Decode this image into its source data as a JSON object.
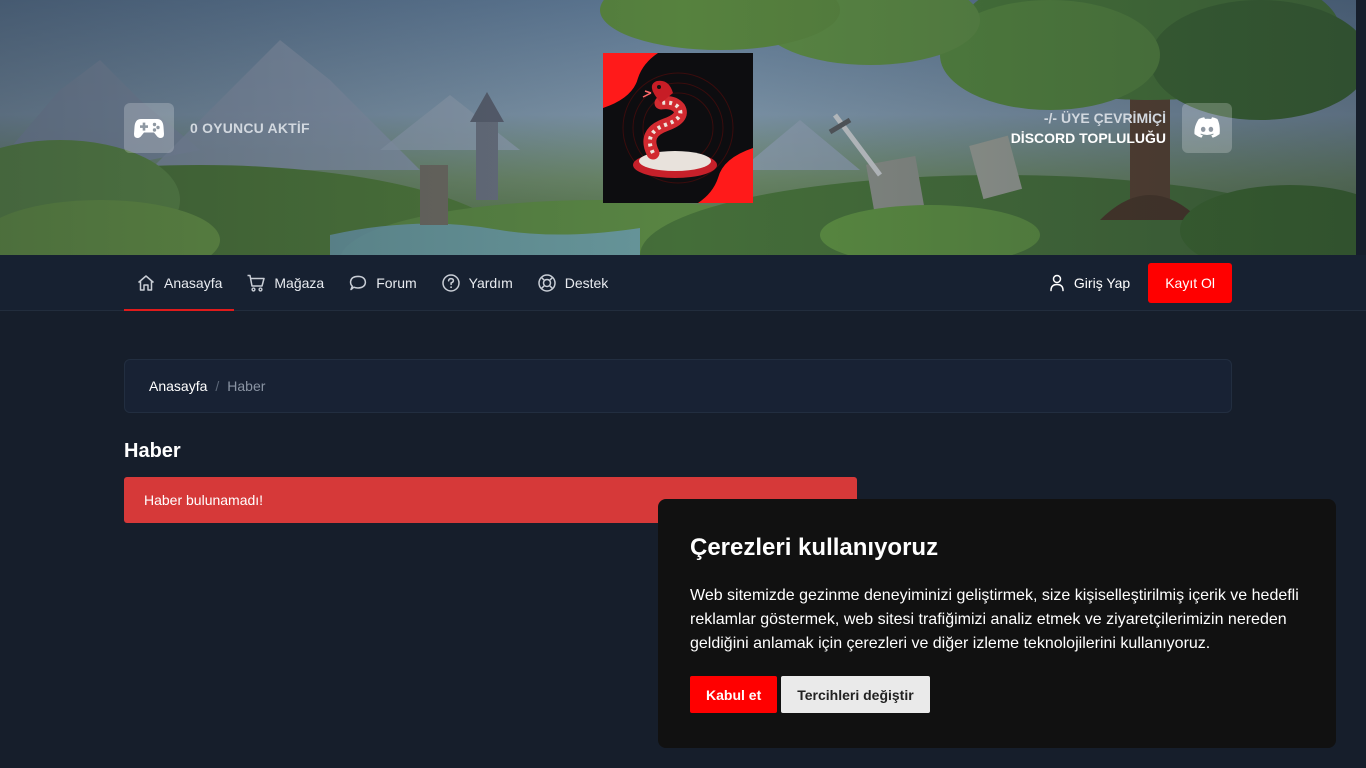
{
  "hero": {
    "players_active": "0 OYUNCU AKTİF",
    "discord_online": "-/- ÜYE ÇEVRİMİÇİ",
    "discord_community": "DİSCORD TOPLULUĞU"
  },
  "nav": {
    "items": [
      {
        "label": "Anasayfa",
        "icon": "home-icon"
      },
      {
        "label": "Mağaza",
        "icon": "cart-icon"
      },
      {
        "label": "Forum",
        "icon": "chat-icon"
      },
      {
        "label": "Yardım",
        "icon": "help-icon"
      },
      {
        "label": "Destek",
        "icon": "lifebuoy-icon"
      }
    ],
    "login": "Giriş Yap",
    "register": "Kayıt Ol"
  },
  "breadcrumb": {
    "home": "Anasayfa",
    "separator": "/",
    "current": "Haber"
  },
  "page": {
    "title": "Haber",
    "alert": "Haber bulunamadı!"
  },
  "cookie": {
    "title": "Çerezleri kullanıyoruz",
    "body": "Web sitemizde gezinme deneyiminizi geliştirmek, size kişiselleştirilmiş içerik ve hedefli reklamlar göstermek, web sitesi trafiğimizi analiz etmek ve ziyaretçilerimizin nereden geldiğini anlamak için çerezleri ve diğer izleme teknolojilerini kullanıyoruz.",
    "accept": "Kabul et",
    "preferences": "Tercihleri değiştir"
  },
  "colors": {
    "accent": "#ff0000",
    "background": "#161e2b",
    "navbar": "#172131",
    "alert": "#d63939"
  }
}
